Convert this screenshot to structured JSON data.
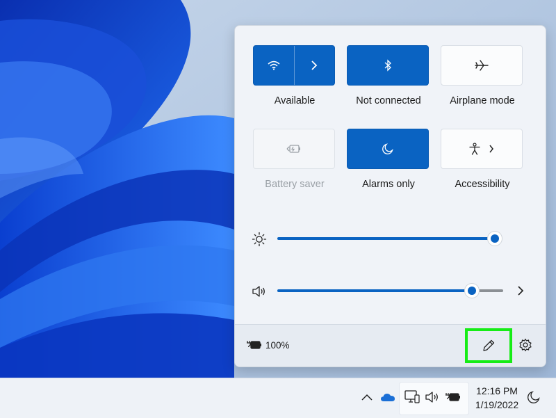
{
  "quick_settings": {
    "tiles": [
      {
        "label": "Available",
        "state": "on",
        "icon": "wifi-icon",
        "secondary_icon": "chevron-right-icon"
      },
      {
        "label": "Not connected",
        "state": "on",
        "icon": "bluetooth-icon"
      },
      {
        "label": "Airplane mode",
        "state": "off",
        "icon": "airplane-icon"
      },
      {
        "label": "Battery saver",
        "state": "disabled",
        "icon": "battery-saver-icon"
      },
      {
        "label": "Alarms only",
        "state": "on",
        "icon": "moon-icon"
      },
      {
        "label": "Accessibility",
        "state": "off",
        "icon": "accessibility-icon",
        "secondary_icon": "chevron-right-icon"
      }
    ],
    "brightness": {
      "icon": "sun-icon",
      "level": 1.0
    },
    "volume": {
      "icon": "speaker-icon",
      "level": 0.86,
      "trailing_icon": "chevron-right-icon"
    },
    "footer": {
      "battery_icon": "battery-charging-icon",
      "battery_text": "100%",
      "edit_icon": "pencil-icon",
      "settings_icon": "gear-icon"
    }
  },
  "taskbar": {
    "tray_icons": [
      "chevron-up-icon",
      "onedrive-cloud-icon",
      "network-icon",
      "speaker-icon",
      "battery-charging-icon",
      "moon-icon"
    ],
    "time": "12:16 PM",
    "date": "1/19/2022"
  },
  "colors": {
    "accent": "#0a63c2",
    "highlight_border": "#16ec16"
  }
}
